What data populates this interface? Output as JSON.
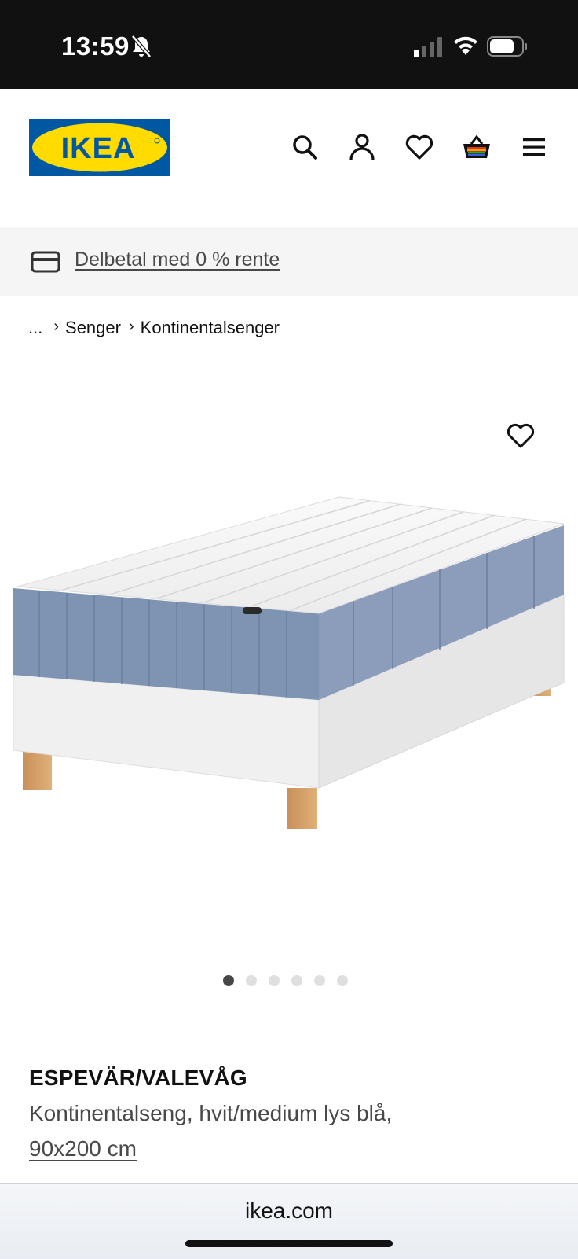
{
  "status_bar": {
    "time": "13:59"
  },
  "header": {
    "logo_text": "IKEA",
    "icons": [
      "search-icon",
      "account-icon",
      "heart-icon",
      "basket-icon",
      "menu-icon"
    ]
  },
  "promo": {
    "link_text": "Delbetal med 0 % rente"
  },
  "breadcrumb": {
    "ellipsis": "...",
    "level1": "Senger",
    "level2": "Kontinentalsenger"
  },
  "gallery": {
    "image_count": 6,
    "active_index": 0
  },
  "product": {
    "name": "ESPEVÄR/VALEVÅG",
    "description": "Kontinentalseng, hvit/medium lys blå,",
    "size": "90x200 cm"
  },
  "browser": {
    "url": "ikea.com"
  },
  "colors": {
    "ikea_blue": "#0058a3",
    "ikea_yellow": "#ffdb00",
    "mattress_blue": "#7f93b3"
  }
}
